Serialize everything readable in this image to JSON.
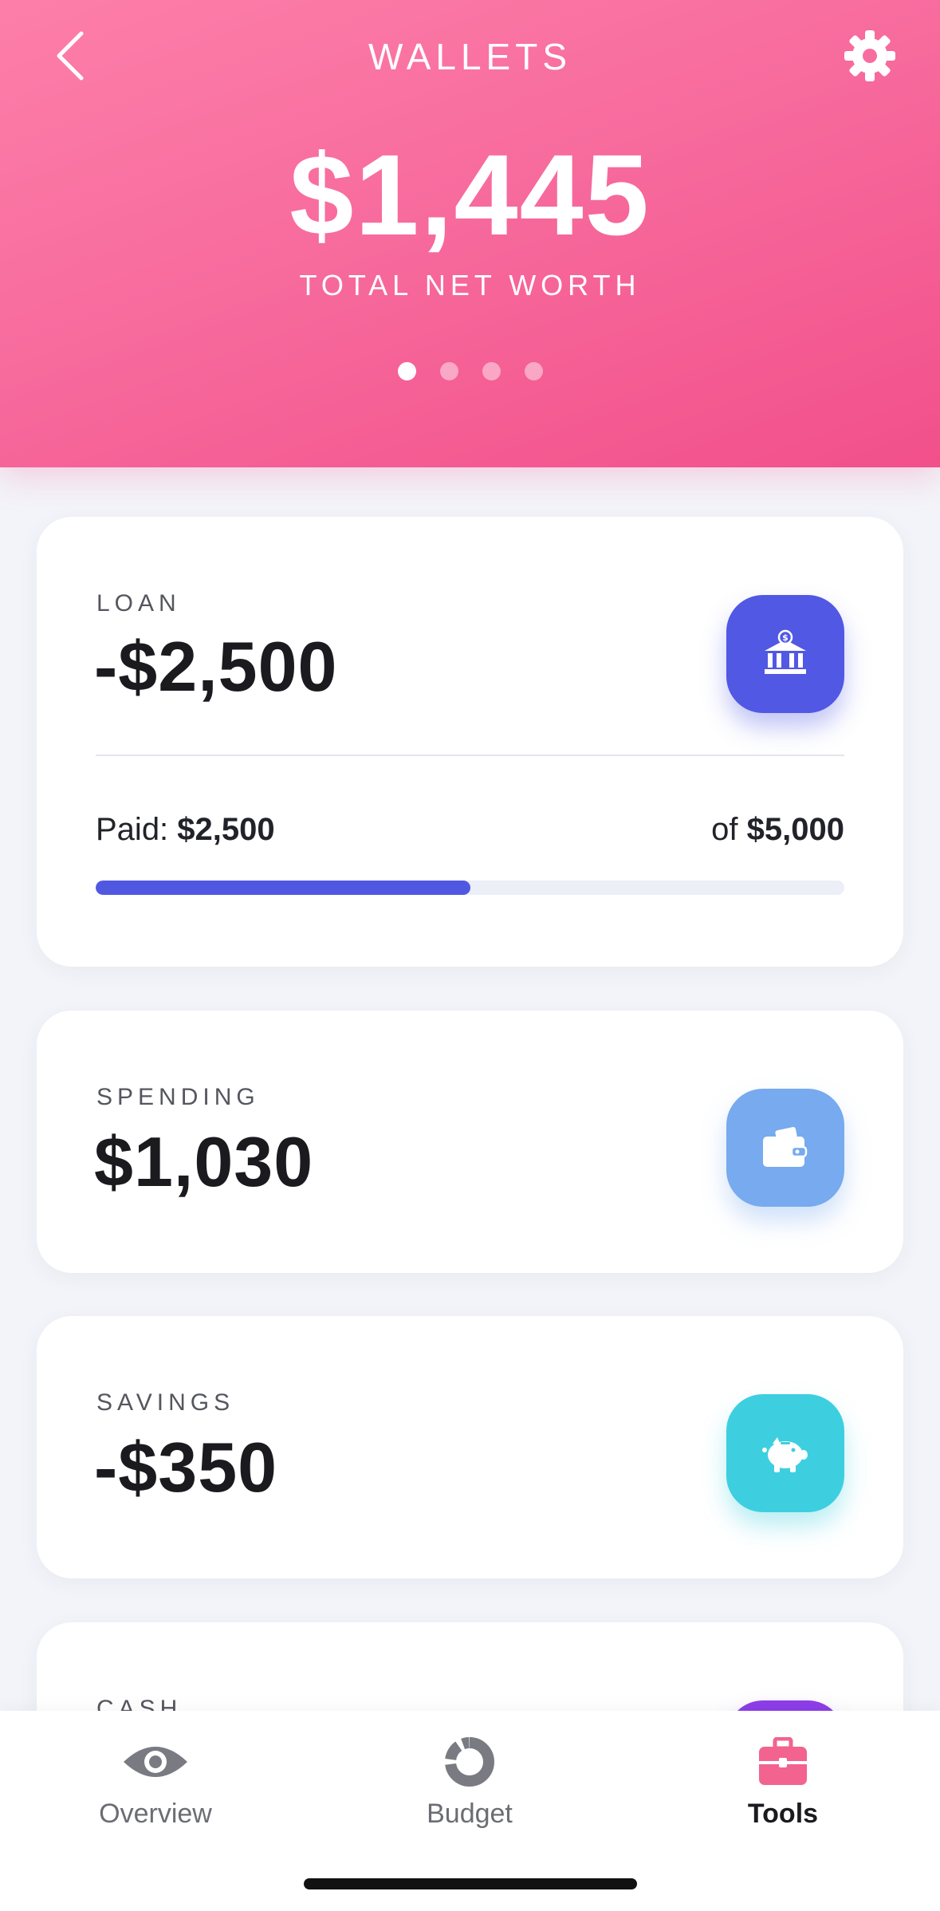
{
  "header": {
    "title": "WALLETS",
    "net_worth": "$1,445",
    "net_worth_label": "TOTAL NET WORTH",
    "page_count": 4,
    "active_page": 1
  },
  "cards": [
    {
      "label": "LOAN",
      "amount": "-$2,500",
      "icon": "bank-icon",
      "icon_color": "#5158e4",
      "paid_prefix": "Paid: ",
      "paid_value": "$2,500",
      "total_prefix": "of ",
      "total_value": "$5,000",
      "progress": 0.5
    },
    {
      "label": "SPENDING",
      "amount": "$1,030",
      "icon": "wallet-icon",
      "icon_color": "#77aaee"
    },
    {
      "label": "SAVINGS",
      "amount": "-$350",
      "icon": "piggy-bank-icon",
      "icon_color": "#3dcfe0"
    },
    {
      "label": "CASH",
      "icon": "cash-icon",
      "icon_color": "#8d3ee8"
    }
  ],
  "tabs": [
    {
      "label": "Overview",
      "icon": "eye-icon"
    },
    {
      "label": "Budget",
      "icon": "donut-chart-icon"
    },
    {
      "label": "Tools",
      "icon": "toolbox-icon",
      "active": true
    }
  ],
  "colors": {
    "header_gradient_start": "#fd7fa9",
    "header_gradient_end": "#f2508a",
    "tools_icon": "#f2638f"
  }
}
